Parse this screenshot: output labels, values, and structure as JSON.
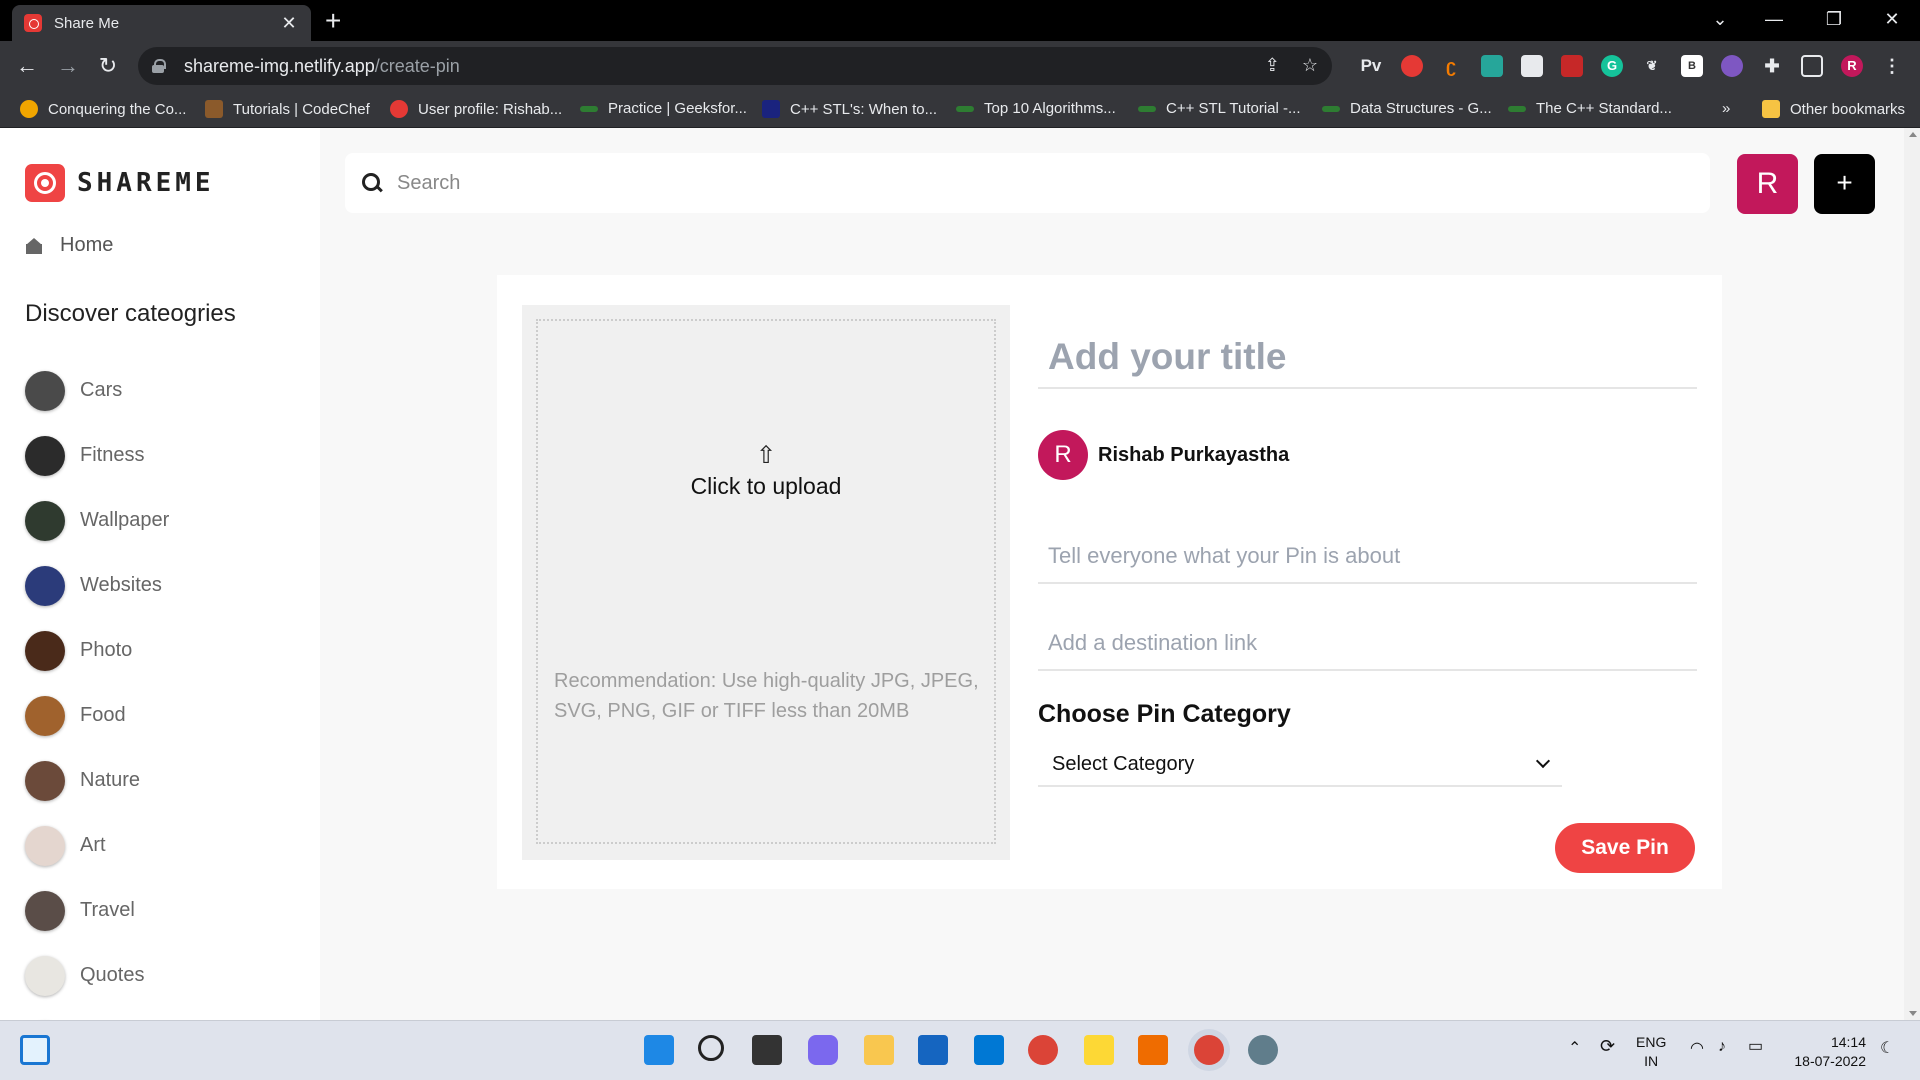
{
  "browser": {
    "tab_title": "Share Me",
    "tab_close": "✕",
    "new_tab": "+",
    "url_host": "shareme-img.netlify.app",
    "url_path": "/create-pin",
    "profile_initial": "R",
    "ext_pv": "Pv",
    "bookmarks": [
      {
        "label": "Conquering the Co...",
        "color": "#f0a500"
      },
      {
        "label": "Tutorials | CodeChef",
        "color": "#8b5a2b"
      },
      {
        "label": "User profile: Rishab...",
        "color": "#e53935"
      },
      {
        "label": "Practice | Geeksfor...",
        "color": "#2e7d32"
      },
      {
        "label": "C++ STL's: When to...",
        "color": "#1a237e"
      },
      {
        "label": "Top 10 Algorithms...",
        "color": "#2e7d32"
      },
      {
        "label": "C++ STL Tutorial -...",
        "color": "#2e7d32"
      },
      {
        "label": "Data Structures - G...",
        "color": "#2e7d32"
      },
      {
        "label": "The C++ Standard...",
        "color": "#2e7d32"
      }
    ],
    "bookmarks_more": "»",
    "other_bookmarks": "Other bookmarks"
  },
  "app": {
    "logo_text": "SHAREME",
    "home_label": "Home",
    "discover_heading": "Discover cateogries",
    "categories": [
      {
        "label": "Cars",
        "color": "#4a4a4a"
      },
      {
        "label": "Fitness",
        "color": "#2b2b2b"
      },
      {
        "label": "Wallpaper",
        "color": "#2f3a2f"
      },
      {
        "label": "Websites",
        "color": "#2b3b7a"
      },
      {
        "label": "Photo",
        "color": "#4a2a1a"
      },
      {
        "label": "Food",
        "color": "#a0622d"
      },
      {
        "label": "Nature",
        "color": "#6b4a3a"
      },
      {
        "label": "Art",
        "color": "#e4d6cf"
      },
      {
        "label": "Travel",
        "color": "#5a4d48"
      },
      {
        "label": "Quotes",
        "color": "#e8e6e1"
      }
    ],
    "search_placeholder": "Search",
    "user_initial": "R",
    "add_symbol": "+"
  },
  "create_pin": {
    "upload_icon": "⇧",
    "upload_label": "Click to upload",
    "upload_recommendation": "Recommendation: Use high-quality JPG, JPEG, SVG, PNG, GIF or TIFF less than 20MB",
    "title_placeholder": "Add your title",
    "author_initial": "R",
    "author_name": "Rishab Purkayastha",
    "about_placeholder": "Tell everyone what your Pin is about",
    "link_placeholder": "Add a destination link",
    "category_heading": "Choose Pin Category",
    "category_selected": "Select Category",
    "save_label": "Save Pin"
  },
  "taskbar": {
    "lang": "ENG",
    "region": "IN",
    "time": "14:14",
    "date": "18-07-2022"
  },
  "colors": {
    "accent_red": "#ef4444",
    "user_pink": "#c2185b"
  }
}
